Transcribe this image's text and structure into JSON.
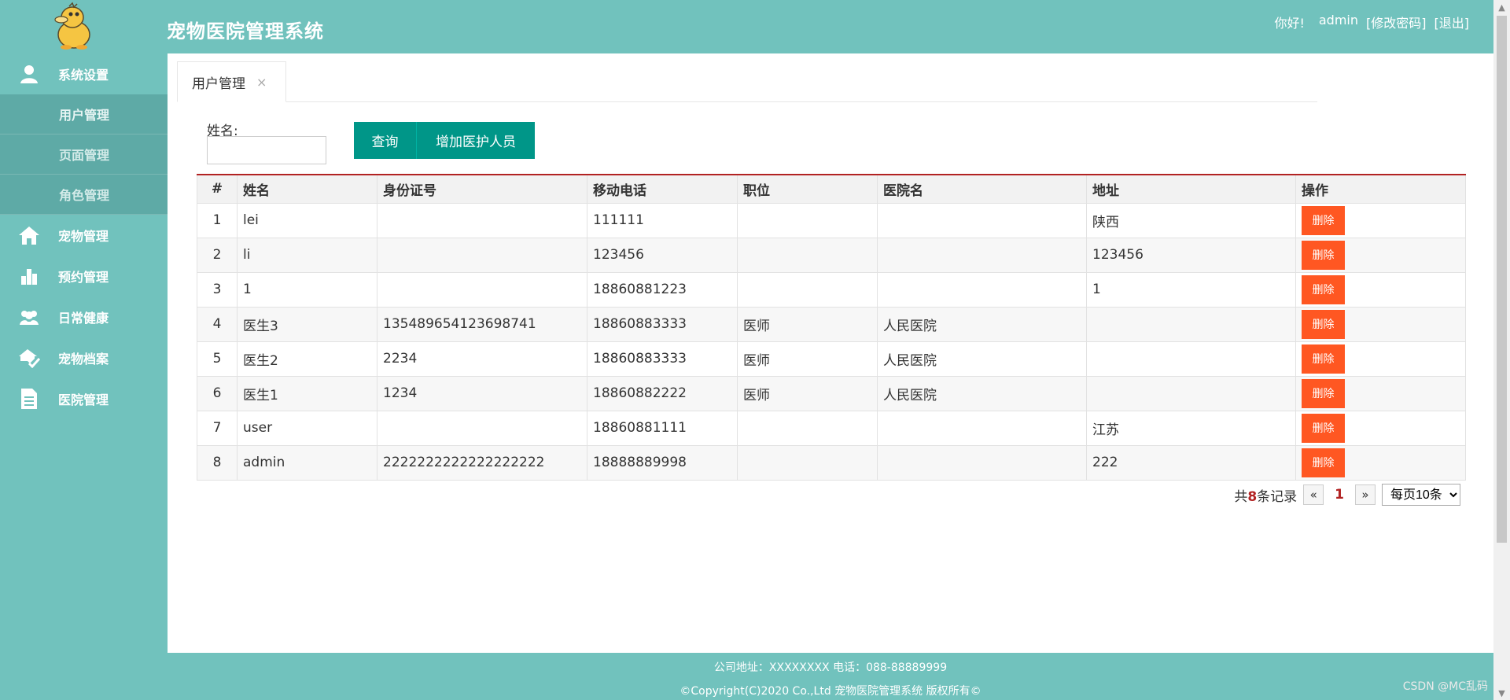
{
  "header": {
    "title": "宠物医院管理系统",
    "greeting": "你好!",
    "username": "admin",
    "change_password": "[修改密码]",
    "logout": "[退出]"
  },
  "sidebar": {
    "groups": [
      {
        "label": "系统设置",
        "icon": "user-icon"
      },
      {
        "label": "宠物管理",
        "icon": "home-icon"
      },
      {
        "label": "预约管理",
        "icon": "bar-chart-icon"
      },
      {
        "label": "日常健康",
        "icon": "group-icon"
      },
      {
        "label": "宠物档案",
        "icon": "house-check-icon"
      },
      {
        "label": "医院管理",
        "icon": "document-icon"
      }
    ],
    "sub_items": [
      "用户管理",
      "页面管理",
      "角色管理"
    ]
  },
  "tabs": [
    {
      "label": "用户管理",
      "close": "×"
    }
  ],
  "search": {
    "label": "姓名:",
    "value": "",
    "placeholder": ""
  },
  "buttons": {
    "query": "查询",
    "add": "增加医护人员"
  },
  "table": {
    "columns": [
      "#",
      "姓名",
      "身份证号",
      "移动电话",
      "职位",
      "医院名",
      "地址",
      "操作"
    ],
    "delete_label": "删除",
    "rows": [
      {
        "idx": "1",
        "name": "lei",
        "id_card": "",
        "phone": "111111",
        "position": "",
        "hospital": "",
        "address": "陕西"
      },
      {
        "idx": "2",
        "name": "li",
        "id_card": "",
        "phone": "123456",
        "position": "",
        "hospital": "",
        "address": "123456"
      },
      {
        "idx": "3",
        "name": "1",
        "id_card": "",
        "phone": "18860881223",
        "position": "",
        "hospital": "",
        "address": "1"
      },
      {
        "idx": "4",
        "name": "医生3",
        "id_card": "135489654123698741",
        "phone": "18860883333",
        "position": "医师",
        "hospital": "人民医院",
        "address": ""
      },
      {
        "idx": "5",
        "name": "医生2",
        "id_card": "2234",
        "phone": "18860883333",
        "position": "医师",
        "hospital": "人民医院",
        "address": ""
      },
      {
        "idx": "6",
        "name": "医生1",
        "id_card": "1234",
        "phone": "18860882222",
        "position": "医师",
        "hospital": "人民医院",
        "address": ""
      },
      {
        "idx": "7",
        "name": "user",
        "id_card": "",
        "phone": "18860881111",
        "position": "",
        "hospital": "",
        "address": "江苏"
      },
      {
        "idx": "8",
        "name": "admin",
        "id_card": "2222222222222222222",
        "phone": "18888889998",
        "position": "",
        "hospital": "",
        "address": "222"
      }
    ]
  },
  "pager": {
    "prefix": "共",
    "count": "8",
    "suffix": "条记录",
    "prev": "«",
    "current": "1",
    "next": "»",
    "page_size": "每页10条"
  },
  "footer": {
    "line1": "公司地址：XXXXXXXX 电话：088-88889999",
    "line2": "©Copyright(C)2020 Co.,Ltd 宠物医院管理系统 版权所有©"
  },
  "watermark": "CSDN @MC乱码",
  "colors": {
    "primary": "#71c2bd",
    "button": "#009688",
    "danger": "#ff5722",
    "accent": "#b22222"
  }
}
